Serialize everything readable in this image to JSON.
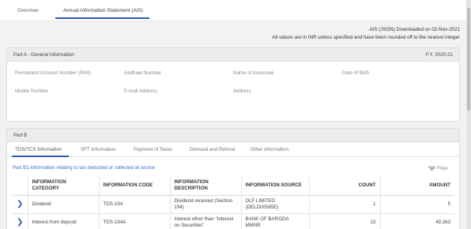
{
  "tabs": [
    {
      "label": "Overview",
      "active": false
    },
    {
      "label": "Annual Information Statement (AIS)",
      "active": true
    }
  ],
  "ais_info": {
    "download_line": "AIS (JSON) Downloaded on 02-Nov-2021",
    "note_line": "All values are in INR unless specified and have been rounded off to the nearest integer"
  },
  "part_a": {
    "title": "Part A - General Information",
    "fy": "F.Y. 2020-21",
    "fields": {
      "pan": "Permanent Account Number (PAN)",
      "aadhaar": "Aadhaar Number",
      "name": "Name of Assessee",
      "dob": "Date of Birth",
      "mobile": "Mobile Number",
      "email": "E-mail Address",
      "address": "Address"
    }
  },
  "part_b": {
    "title": "Part B",
    "subtabs": [
      {
        "label": "TDS/TCS Information",
        "active": true
      },
      {
        "label": "SFT Information",
        "active": false
      },
      {
        "label": "Payment of Taxes",
        "active": false
      },
      {
        "label": "Demand and Refund",
        "active": false
      },
      {
        "label": "Other Information",
        "active": false
      }
    ],
    "section_title": "Part B1-Information relating to tax deducted or collected at source",
    "filter_label": "Filter",
    "table": {
      "headers": {
        "category": "INFORMATION CATEGORY",
        "code": "INFORMATION CODE",
        "description": "INFORMATION DESCRIPTION",
        "source": "INFORMATION SOURCE",
        "count": "COUNT",
        "amount": "AMOUNT"
      },
      "rows": [
        {
          "category": "Dividend",
          "code": "TDS-194",
          "description": "Dividend received (Section 194)",
          "source": "DLF LIMITED (DELD00585E)",
          "count": "1",
          "amount": "5"
        },
        {
          "category": "Interest from deposit",
          "code": "TDS-194A",
          "description": "Interest other than \"Interest on Securities\"",
          "source": "BANK OF BARODA MMNR",
          "count": "15",
          "amount": "49,363"
        }
      ]
    }
  },
  "colors": {
    "accent": "#2f56b0",
    "link": "#2f6fd6",
    "header_bg": "#ececec",
    "page_bg": "#f2f2f2"
  }
}
